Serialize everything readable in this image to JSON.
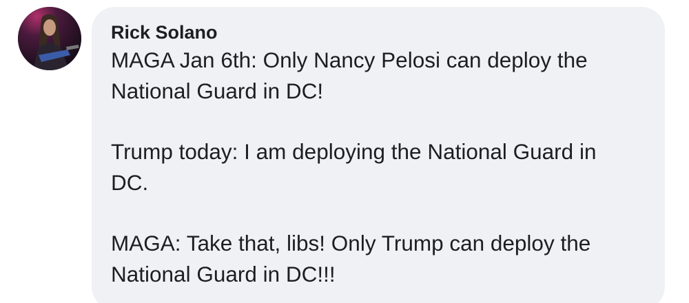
{
  "comment": {
    "author_name": "Rick Solano",
    "avatar_icon": "user-avatar-photo",
    "paragraphs": [
      {
        "lines": [
          "MAGA Jan 6th: Only Nancy Pelosi can deploy the",
          "National Guard in DC!"
        ]
      },
      {
        "lines": [
          "Trump today: I am deploying the National Guard in",
          "DC."
        ]
      },
      {
        "lines": [
          "MAGA: Take that, libs! Only Trump can deploy the",
          "National Guard in DC!!!"
        ]
      }
    ]
  },
  "colors": {
    "bubble_background": "#eff1f5",
    "text": "#1c1e21",
    "page_background": "#ffffff"
  }
}
